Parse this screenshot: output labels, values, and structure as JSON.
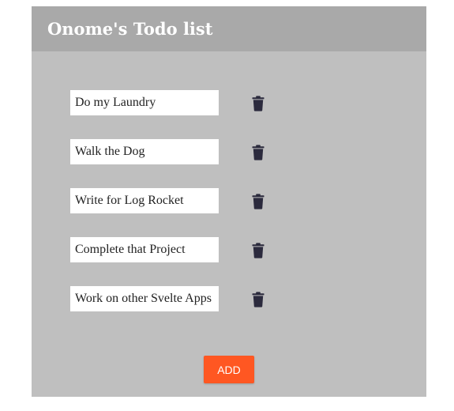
{
  "app": {
    "title": "Onome's Todo list"
  },
  "todos": [
    {
      "value": "Do my Laundry",
      "delete_icon": "trash-icon"
    },
    {
      "value": "Walk the Dog",
      "delete_icon": "trash-icon"
    },
    {
      "value": "Write for Log Rocket",
      "delete_icon": "trash-icon"
    },
    {
      "value": "Complete that Project",
      "delete_icon": "trash-icon"
    },
    {
      "value": "Work on other Svelte Apps",
      "delete_icon": "trash-icon"
    }
  ],
  "actions": {
    "add_label": "ADD"
  },
  "colors": {
    "header_bg": "#a9a9a9",
    "panel_bg": "#bfbfbf",
    "accent": "#ff5722",
    "icon": "#2b2a3d"
  }
}
